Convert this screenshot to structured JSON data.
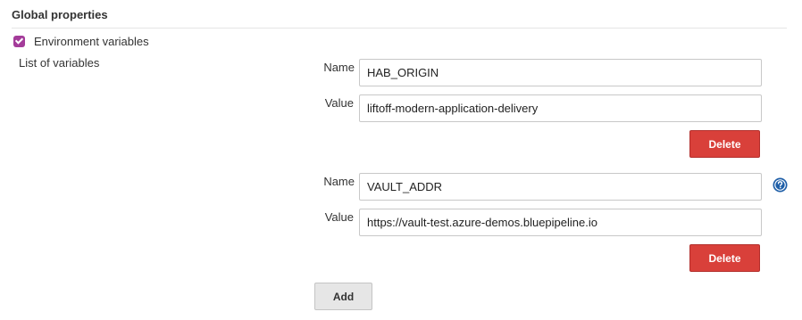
{
  "section": {
    "title": "Global properties"
  },
  "env_vars": {
    "checkbox_label": "Environment variables",
    "checked": true,
    "list_label": "List of variables",
    "name_label": "Name",
    "value_label": "Value",
    "entries": [
      {
        "name": "HAB_ORIGIN",
        "value": "liftoff-modern-application-delivery",
        "delete_label": "Delete"
      },
      {
        "name": "VAULT_ADDR",
        "value": "https://vault-test.azure-demos.bluepipeline.io",
        "delete_label": "Delete"
      }
    ],
    "add_label": "Add",
    "help_icon": "question-circle-icon"
  },
  "colors": {
    "checkbox": "#a43c9a",
    "delete_button": "#d9403a",
    "help_icon": "#1f5fa8"
  }
}
